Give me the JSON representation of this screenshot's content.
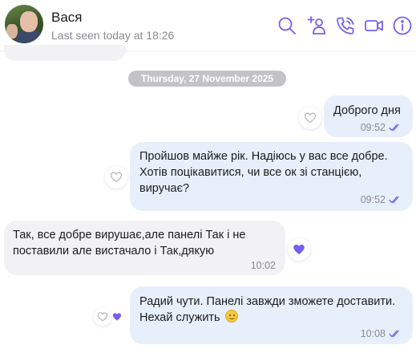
{
  "header": {
    "contact_name": "Вася",
    "last_seen": "Last seen today at 18:26",
    "icons": [
      "search-icon",
      "add-contact-icon",
      "phone-icon",
      "video-call-icon",
      "info-icon"
    ],
    "icon_color": "#7360f2"
  },
  "date_separator": "Thursday, 27 November 2025",
  "messages": [
    {
      "direction": "out",
      "text": "Доброго дня",
      "time": "09:52",
      "status": "read",
      "reaction": "heart-outline-icon"
    },
    {
      "direction": "out",
      "text": "Пройшов майже рік. Надіюсь у вас все добре.\nХотів поцікавитися, чи все ок зі станцією,\nвиручає?",
      "time": "09:52",
      "status": "read",
      "reaction": "heart-outline-icon"
    },
    {
      "direction": "in",
      "text": "Так, все добре вирушає,але панелі Так і не\nпоставили але вистачало і Так,дякую",
      "time": "10:02",
      "reaction": "purple-heart-icon"
    },
    {
      "direction": "out",
      "text": "Радий чути. Панелі завжди зможете доставити.\nНехай служить",
      "emoji": "smile-emoji",
      "time": "10:08",
      "status": "read",
      "reactions": [
        "heart-outline-icon",
        "purple-heart-icon"
      ]
    }
  ],
  "colors": {
    "accent": "#7360f2",
    "outgoing_bubble": "#e7effb",
    "incoming_bubble": "#f2f2f4",
    "read_ticks": "#7360f2"
  }
}
